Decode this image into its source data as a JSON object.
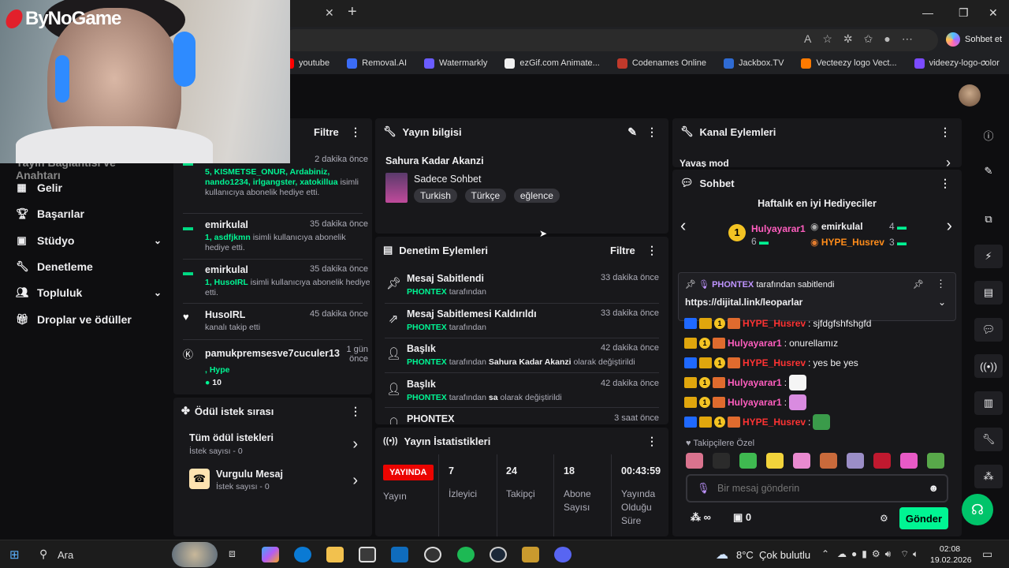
{
  "browser": {
    "tab_close": "✕",
    "tab_new": "+",
    "copilot_label": "Sohbet et",
    "bookmarks": [
      {
        "label": "youtube",
        "color": "#ff0000"
      },
      {
        "label": "Removal.AI",
        "color": "#3b6cf6"
      },
      {
        "label": "Watermarkly",
        "color": "#6a5cff"
      },
      {
        "label": "ezGif.com Animate...",
        "color": "#f0f0f0"
      },
      {
        "label": "Codenames Online",
        "color": "#c0392b"
      },
      {
        "label": "Jackbox.TV",
        "color": "#2f6bd3"
      },
      {
        "label": "Vecteezy logo Vect...",
        "color": "#ff7a00"
      },
      {
        "label": "videezy-logo-color",
        "color": "#7b4bff"
      }
    ]
  },
  "overlay": {
    "logo_text": "ByNoGame"
  },
  "leftnav": {
    "partial_item": "Yayın Bağlantısı ve Anahtarı",
    "items": [
      "Gelir",
      "Başarılar",
      "Stüdyo",
      "Denetleme",
      "Topluluk",
      "Droplar ve ödüller"
    ]
  },
  "activity": {
    "filter_label": "Filtre",
    "items": [
      {
        "name": "",
        "time": "2 dakika önce",
        "desc_users": "5, KISMETSE_ONUR, Ardabiniz, nando1234, irlgangster, xatokillua",
        "desc_text": "isimli kullanıcıya abonelik hediye etti."
      },
      {
        "name": "emirkulal",
        "time": "35 dakika önce",
        "desc_users": "1, asdfjkmn",
        "desc_text": "isimli kullanıcıya abonelik hediye etti."
      },
      {
        "name": "emirkulal",
        "time": "35 dakika önce",
        "desc_users": "1, HusoIRL",
        "desc_text": "isimli kullanıcıya abonelik hediye etti."
      },
      {
        "name": "HusoIRL",
        "time": "45 dakika önce",
        "desc_text": "kanalı takip etti"
      },
      {
        "name": "pamukpremsesve7cuculer13",
        "time": "1 gün önce",
        "desc_text": ", Hype",
        "amount": "10"
      }
    ]
  },
  "rewards": {
    "title": "Ödül istek sırası",
    "items": [
      {
        "title": "Tüm ödül istekleri",
        "sub": "İstek sayısı - 0"
      },
      {
        "title": "Vurgulu Mesaj",
        "sub": "İstek sayısı - 0"
      }
    ]
  },
  "stream_info": {
    "title": "Yayın bilgisi",
    "stream_title": "Sahura Kadar Akanzi",
    "category": "Sadece Sohbet",
    "tags": [
      "Turkish",
      "Türkçe",
      "eğlence"
    ]
  },
  "moderation": {
    "title": "Denetim Eylemleri",
    "filter_label": "Filtre",
    "rows": [
      {
        "title": "Mesaj Sabitlendi",
        "user": "PHONTEX",
        "suffix": "tarafından",
        "time": "33 dakika önce"
      },
      {
        "title": "Mesaj Sabitlemesi Kaldırıldı",
        "user": "PHONTEX",
        "suffix": "tarafından",
        "time": "33 dakika önce"
      },
      {
        "title": "Başlık",
        "user": "PHONTEX",
        "suffix": "tarafından",
        "bold": "Sahura Kadar Akanzi",
        "suffix2": "olarak değiştirildi",
        "time": "42 dakika önce"
      },
      {
        "title": "Başlık",
        "user": "PHONTEX",
        "suffix": "tarafından",
        "bold": "sa",
        "suffix2": "olarak değiştirildi",
        "time": "42 dakika önce"
      },
      {
        "title": "PHONTEX",
        "time": "3 saat önce"
      }
    ]
  },
  "stats": {
    "title": "Yayın İstatistikleri",
    "live_badge": "YAYINDA",
    "live_label": "Yayın",
    "viewers": {
      "value": "7",
      "label": "İzleyici"
    },
    "followers": {
      "value": "24",
      "label": "Takipçi"
    },
    "subs": {
      "value": "18",
      "label": "Abone Sayısı"
    },
    "uptime": {
      "value": "00:43:59",
      "label": "Yayında Olduğu Süre"
    }
  },
  "channel_actions": {
    "title": "Kanal Eylemleri",
    "item": "Yavaş mod"
  },
  "chat": {
    "title": "Sohbet",
    "gifters_title": "Haftalık en iyi Hediyeciler",
    "gifters": [
      {
        "name": "Hulyayarar1",
        "count": "6"
      },
      {
        "name": "emirkulal",
        "count": "4"
      },
      {
        "name": "HYPE_Husrev",
        "count": "3"
      }
    ],
    "pinned_by": "PHONTEX",
    "pinned_suffix": "tarafından sabitlendi",
    "pinned_link": "https://dijital.link/leoparlar",
    "messages": [
      {
        "user": "HYPE_Husrev",
        "text": "sjfdgfshfshgfd",
        "color": "red"
      },
      {
        "user": "Hulyayarar1",
        "text": "onurellamız",
        "color": "pink"
      },
      {
        "user": "HYPE_Husrev",
        "text": "yes be yes",
        "color": "red"
      },
      {
        "user": "Hulyayarar1",
        "text": "",
        "color": "pink",
        "emote": "#f5f5f5"
      },
      {
        "user": "Hulyayarar1",
        "text": "",
        "color": "pink",
        "emote": "#d98be0"
      },
      {
        "user": "HYPE_Husrev",
        "text": "",
        "color": "red",
        "emote": "#3a9b4a"
      }
    ],
    "follower_only": "Takipçilere Özel",
    "emotes": [
      "#d9738e",
      "#2b2b2b",
      "#3fb950",
      "#f2d33b",
      "#e98ad0",
      "#c96a3b",
      "#9b8ec7",
      "#c0192f",
      "#e85ac6",
      "#58a84a"
    ],
    "input_placeholder": "Bir mesaj gönderin",
    "points": "∞",
    "chest_count": "0",
    "send_label": "Gönder"
  },
  "taskbar": {
    "search": "Ara",
    "weather": "8°C  Çok bulutlu",
    "time": "02:08",
    "date": "19.02.2026"
  }
}
